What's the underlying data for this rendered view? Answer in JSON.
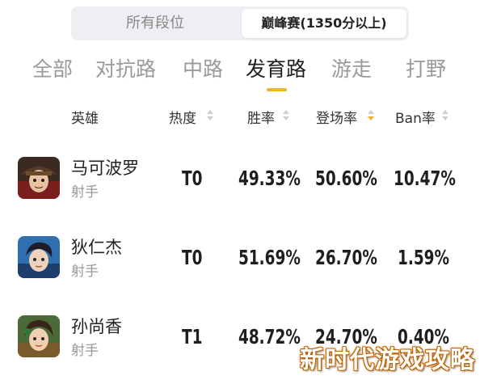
{
  "rank_filter": {
    "options": [
      "所有段位",
      "巅峰赛(1350分以上)"
    ],
    "selected": "巅峰赛(1350分以上)"
  },
  "lane_tabs": [
    "全部",
    "对抗路",
    "中路",
    "发育路",
    "游走",
    "打野"
  ],
  "active_tab": "发育路",
  "columns": {
    "hero": "英雄",
    "heat": "热度",
    "win_rate": "胜率",
    "pick_rate": "登场率",
    "ban_rate": "Ban率"
  },
  "sorted_column": "pick_rate",
  "heroes": [
    {
      "name": "马可波罗",
      "role": "射手",
      "tier": "T0",
      "win_rate": "49.33%",
      "pick_rate": "50.60%",
      "ban_rate": "10.47%",
      "avatar_icon": "marco-polo-avatar-icon"
    },
    {
      "name": "狄仁杰",
      "role": "射手",
      "tier": "T0",
      "win_rate": "51.69%",
      "pick_rate": "26.70%",
      "ban_rate": "1.59%",
      "avatar_icon": "direnjie-avatar-icon"
    },
    {
      "name": "孙尚香",
      "role": "射手",
      "tier": "T1",
      "win_rate": "48.72%",
      "pick_rate": "24.70%",
      "ban_rate": "0.40%",
      "avatar_icon": "sunshangxiang-avatar-icon"
    }
  ],
  "watermark": "新时代游戏攻略",
  "colors": {
    "accent": "#f3b22b",
    "inactive_text": "#9a9a9a",
    "segment_bg": "#eeeff2"
  }
}
